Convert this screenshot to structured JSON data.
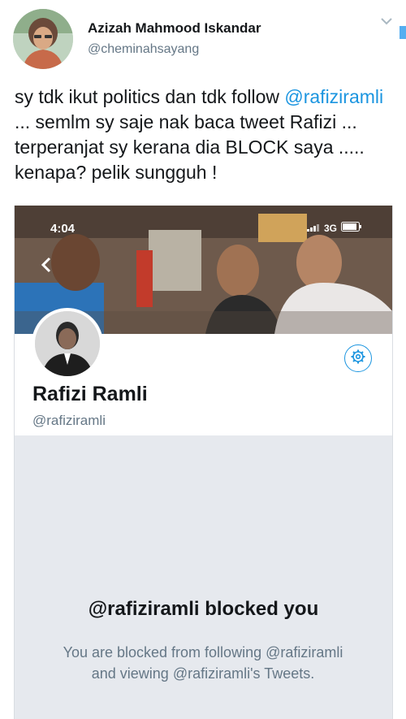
{
  "tweet": {
    "author_name": "Azizah Mahmood Iskandar",
    "author_handle": "@cheminahsayang",
    "text_part1": "sy tdk ikut politics dan tdk follow ",
    "mention": "@rafiziramli",
    "text_part2": " ... semlm sy saje nak baca tweet Rafizi ... terperanjat sy kerana dia BLOCK saya ..... kenapa? pelik sungguh !"
  },
  "embed": {
    "status_bar": {
      "time": "4:04",
      "network": "3G"
    },
    "profile": {
      "name": "Rafizi Ramli",
      "handle": "@rafiziramli"
    },
    "blocked": {
      "title": "@rafiziramli blocked you",
      "message": "You are blocked from following @rafiziramli and viewing @rafiziramli's Tweets."
    }
  },
  "icons": {
    "caret": "chevron-down-icon",
    "back": "back-chevron-icon",
    "settings": "gear-icon",
    "signal": "signal-icon",
    "battery": "battery-icon"
  },
  "colors": {
    "link": "#1b95e0",
    "secondary_text": "#657786",
    "primary_text": "#14171a",
    "blocked_background": "#e6e9ee"
  }
}
